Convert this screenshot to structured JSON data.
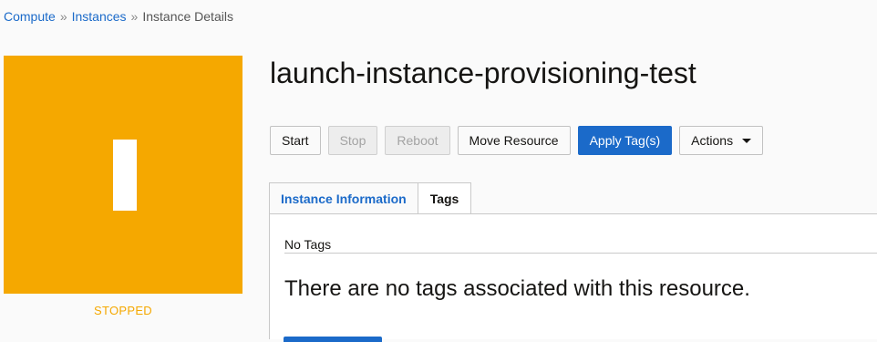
{
  "breadcrumb": {
    "items": [
      "Compute",
      "Instances",
      "Instance Details"
    ],
    "separator": "»"
  },
  "instance": {
    "title": "launch-instance-provisioning-test",
    "icon_letter": "I",
    "state": "STOPPED",
    "tile_color": "#f5a800"
  },
  "toolbar": {
    "start": "Start",
    "stop": "Stop",
    "reboot": "Reboot",
    "move_resource": "Move Resource",
    "apply_tags": "Apply Tag(s)",
    "actions": "Actions"
  },
  "tabs": [
    {
      "label": "Instance Information",
      "active": false
    },
    {
      "label": "Tags",
      "active": true
    }
  ],
  "tags_panel": {
    "heading": "No Tags",
    "message": "There are no tags associated with this resource."
  },
  "colors": {
    "link": "#1b6ac9",
    "primary": "#1b6ac9",
    "stopped": "#f5a800"
  }
}
